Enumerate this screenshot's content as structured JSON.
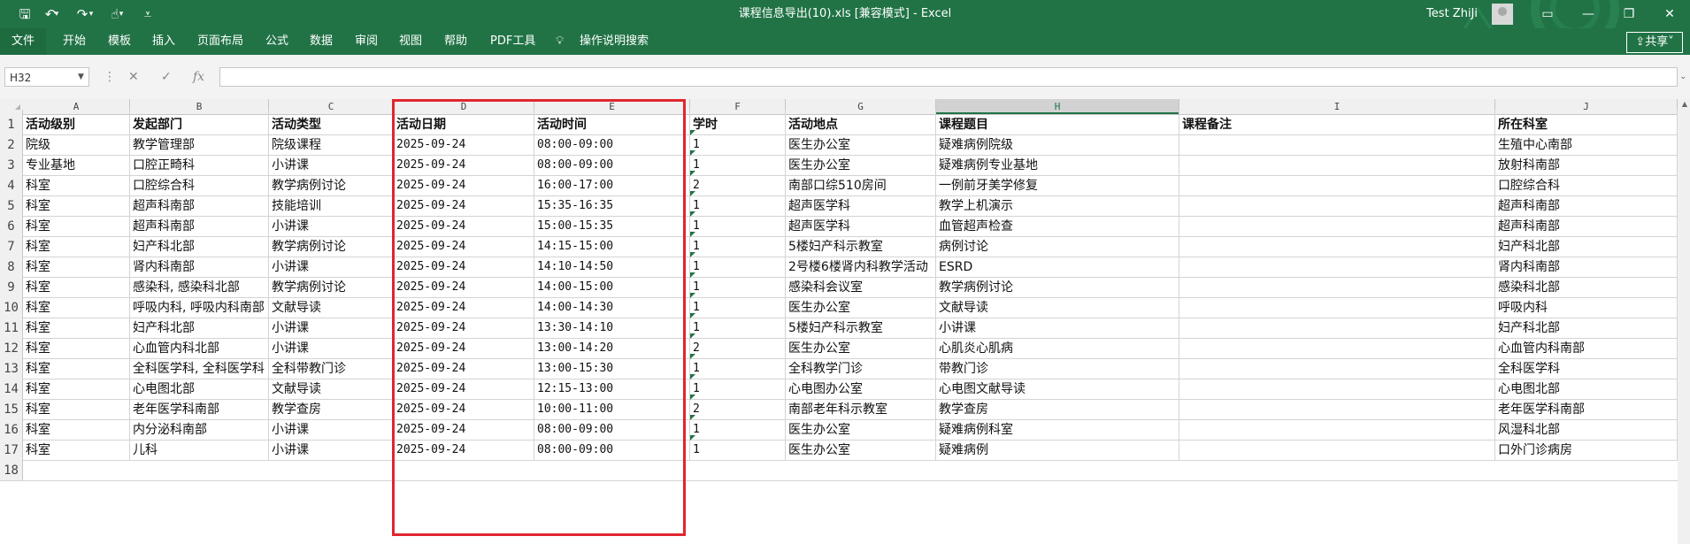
{
  "app": {
    "title": "课程信息导出(10).xls  [兼容模式]  -  Excel",
    "user": "Test ZhiJi",
    "share": "共享"
  },
  "quick_access": [
    {
      "name": "save-icon",
      "glyph": "🖫"
    },
    {
      "name": "undo-icon",
      "glyph": "↶"
    },
    {
      "name": "undo-dropdown-icon",
      "glyph": "▾"
    },
    {
      "name": "redo-icon",
      "glyph": "↷"
    },
    {
      "name": "redo-dropdown-icon",
      "glyph": "▾"
    },
    {
      "name": "touch-mode-icon",
      "glyph": "☝"
    },
    {
      "name": "touch-dropdown-icon",
      "glyph": "▾"
    },
    {
      "name": "customize-qat-icon",
      "glyph": "⩡"
    }
  ],
  "ribbon_tabs": [
    "文件",
    "开始",
    "模板",
    "插入",
    "页面布局",
    "公式",
    "数据",
    "审阅",
    "视图",
    "帮助",
    "PDF工具",
    "操作说明搜索"
  ],
  "formula_bar": {
    "name_box": "H32",
    "formula": ""
  },
  "columns": [
    {
      "letter": "A",
      "selected": false
    },
    {
      "letter": "B",
      "selected": false
    },
    {
      "letter": "C",
      "selected": false
    },
    {
      "letter": "D",
      "selected": false
    },
    {
      "letter": "E",
      "selected": false
    },
    {
      "letter": "F",
      "selected": false
    },
    {
      "letter": "G",
      "selected": false
    },
    {
      "letter": "H",
      "selected": true
    },
    {
      "letter": "I",
      "selected": false
    },
    {
      "letter": "J",
      "selected": false
    }
  ],
  "table": {
    "headers": [
      "活动级别",
      "发起部门",
      "活动类型",
      "活动日期",
      "活动时间",
      "学时",
      "活动地点",
      "课程题目",
      "课程备注",
      "所在科室"
    ],
    "rows": [
      [
        "院级",
        "教学管理部",
        "院级课程",
        "2025-09-24",
        "08:00-09:00",
        "1",
        "医生办公室",
        "疑难病例院级",
        "",
        "生殖中心南部"
      ],
      [
        "专业基地",
        "口腔正畸科",
        "小讲课",
        "2025-09-24",
        "08:00-09:00",
        "1",
        "医生办公室",
        "疑难病例专业基地",
        "",
        "放射科南部"
      ],
      [
        "科室",
        "口腔综合科",
        "教学病例讨论",
        "2025-09-24",
        "16:00-17:00",
        "2",
        "南部口综510房间",
        "一例前牙美学修复",
        "",
        "口腔综合科"
      ],
      [
        "科室",
        "超声科南部",
        "技能培训",
        "2025-09-24",
        "15:35-16:35",
        "1",
        "超声医学科",
        "教学上机演示",
        "",
        "超声科南部"
      ],
      [
        "科室",
        "超声科南部",
        "小讲课",
        "2025-09-24",
        "15:00-15:35",
        "1",
        "超声医学科",
        "血管超声检查",
        "",
        "超声科南部"
      ],
      [
        "科室",
        "妇产科北部",
        "教学病例讨论",
        "2025-09-24",
        "14:15-15:00",
        "1",
        "5楼妇产科示教室",
        "病例讨论",
        "",
        "妇产科北部"
      ],
      [
        "科室",
        "肾内科南部",
        "小讲课",
        "2025-09-24",
        "14:10-14:50",
        "1",
        "2号楼6楼肾内科教学活动",
        "ESRD",
        "",
        "肾内科南部"
      ],
      [
        "科室",
        "感染科, 感染科北部",
        "教学病例讨论",
        "2025-09-24",
        "14:00-15:00",
        "1",
        "感染科会议室",
        "教学病例讨论",
        "",
        "感染科北部"
      ],
      [
        "科室",
        "呼吸内科, 呼吸内科南部",
        "文献导读",
        "2025-09-24",
        "14:00-14:30",
        "1",
        "医生办公室",
        "文献导读",
        "",
        "呼吸内科"
      ],
      [
        "科室",
        "妇产科北部",
        "小讲课",
        "2025-09-24",
        "13:30-14:10",
        "1",
        "5楼妇产科示教室",
        "小讲课",
        "",
        "妇产科北部"
      ],
      [
        "科室",
        "心血管内科北部",
        "小讲课",
        "2025-09-24",
        "13:00-14:20",
        "2",
        "医生办公室",
        "心肌炎心肌病",
        "",
        "心血管内科南部"
      ],
      [
        "科室",
        "全科医学科, 全科医学科",
        "全科带教门诊",
        "2025-09-24",
        "13:00-15:30",
        "1",
        "全科教学门诊",
        "带教门诊",
        "",
        "全科医学科"
      ],
      [
        "科室",
        "心电图北部",
        "文献导读",
        "2025-09-24",
        "12:15-13:00",
        "1",
        "心电图办公室",
        "心电图文献导读",
        "",
        "心电图北部"
      ],
      [
        "科室",
        "老年医学科南部",
        "教学查房",
        "2025-09-24",
        "10:00-11:00",
        "2",
        "南部老年科示教室",
        "教学查房",
        "",
        "老年医学科南部"
      ],
      [
        "科室",
        "内分泌科南部",
        "小讲课",
        "2025-09-24",
        "08:00-09:00",
        "1",
        "医生办公室",
        "疑难病例科室",
        "",
        "风湿科北部"
      ],
      [
        "科室",
        "儿科",
        "小讲课",
        "2025-09-24",
        "08:00-09:00",
        "1",
        "医生办公室",
        "疑难病例",
        "",
        "口外门诊病房"
      ]
    ]
  }
}
